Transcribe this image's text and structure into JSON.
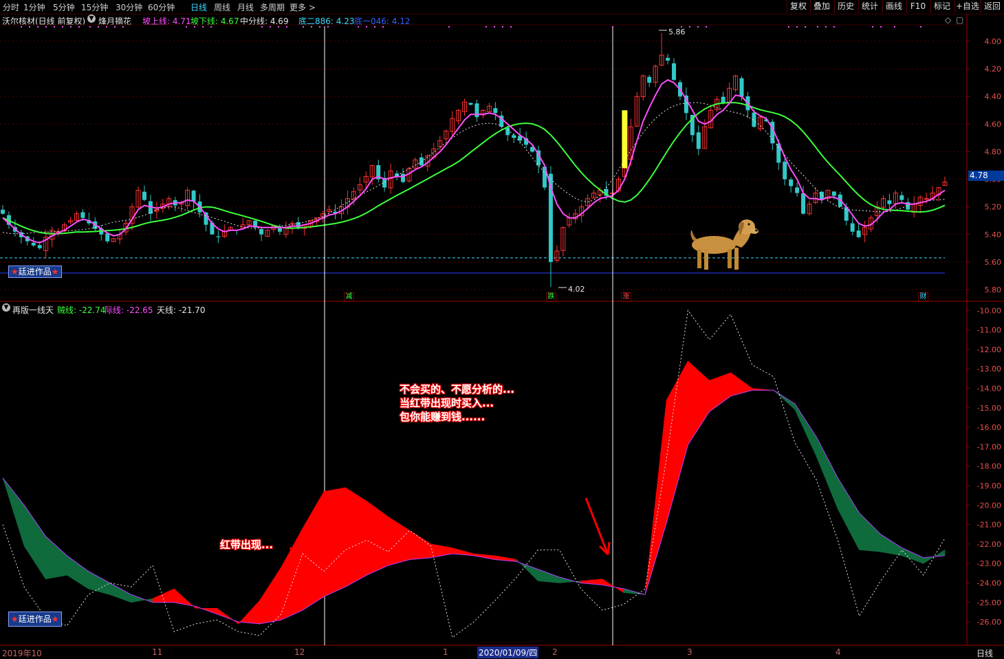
{
  "toolbar": {
    "periods": [
      "分时",
      "1分钟",
      "5分钟",
      "15分钟",
      "30分钟",
      "60分钟",
      "日线",
      "周线",
      "月线",
      "多周期",
      "更多 >"
    ],
    "active": "日线",
    "right": [
      "复权",
      "叠加",
      "历史",
      "统计",
      "画线",
      "F10",
      "标记",
      "+自选",
      "返回"
    ]
  },
  "main": {
    "title": "沃尔核材(日线 前复权)",
    "formula": "烽月摘花",
    "ind": [
      {
        "label": "坡上线: 4.71",
        "color": "#ff4fff"
      },
      {
        "label": "坡下线: 4.67",
        "color": "#3cff3c"
      },
      {
        "label": "中分线: 4.69",
        "color": "#e6e6e6"
      },
      {
        "label": "底二886: 4.23",
        "color": "#3fd9ff"
      },
      {
        "label": "底一046: 4.12",
        "color": "#3060ff"
      }
    ],
    "high_label": "5.86",
    "low_label": "4.02",
    "price_tag": "4.78",
    "yticks": [
      "5.80",
      "5.60",
      "5.40",
      "5.20",
      "5.00",
      "4.80",
      "4.60",
      "4.40",
      "4.20",
      "4.00"
    ],
    "marks": [
      {
        "text": "减",
        "color": "#3cff3c"
      },
      {
        "text": "跌",
        "color": "#3cff3c"
      },
      {
        "text": "涨",
        "color": "#ff5050"
      },
      {
        "text": "财",
        "color": "#3fd9ff"
      }
    ],
    "badge": "廷进作品"
  },
  "sub": {
    "title": "再版一线天",
    "ind": [
      {
        "label": "贼线: -22.74",
        "color": "#3cff3c"
      },
      {
        "label": "际线: -22.65",
        "color": "#ff4fff"
      },
      {
        "label": "天线: -21.70",
        "color": "#e6e6e6"
      }
    ],
    "yticks": [
      "-10.00",
      "-11.00",
      "-12.00",
      "-13.00",
      "-14.00",
      "-15.00",
      "-16.00",
      "-17.00",
      "-18.00",
      "-19.00",
      "-20.00",
      "-21.00",
      "-22.00",
      "-23.00",
      "-24.00",
      "-25.00",
      "-26.00"
    ],
    "badge": "廷进作品",
    "annot_big": "不会买的、不愿分析的...\n当红带出现时买入...\n包你能赚到钱......",
    "annot_small": "红带出现..."
  },
  "xaxis": {
    "labels": [
      "2019年10",
      "11",
      "12",
      "1",
      "2020/01/09/四",
      "2",
      "3",
      "4"
    ],
    "corner": "日线"
  },
  "chart_data": [
    {
      "type": "candlestick",
      "title": "沃尔核材(日线 前复权)",
      "ylim": [
        4.0,
        5.86
      ],
      "yticks": [
        4.0,
        4.2,
        4.4,
        4.6,
        4.8,
        5.0,
        5.2,
        5.4,
        5.6,
        5.8
      ],
      "price_high": 5.86,
      "price_low": 4.02,
      "last_price": 4.78,
      "indicators": {
        "坡上线": 4.71,
        "坡下线": 4.67,
        "中分线": 4.69,
        "底二886": 4.23,
        "底一046": 4.12
      },
      "closes": [
        4.55,
        4.47,
        4.42,
        4.38,
        4.35,
        4.32,
        4.3,
        4.38,
        4.43,
        4.42,
        4.47,
        4.5,
        4.55,
        4.52,
        4.48,
        4.44,
        4.4,
        4.35,
        4.37,
        4.4,
        4.48,
        4.6,
        4.72,
        4.65,
        4.55,
        4.58,
        4.62,
        4.66,
        4.61,
        4.63,
        4.72,
        4.64,
        4.56,
        4.47,
        4.4,
        4.38,
        4.42,
        4.45,
        4.43,
        4.47,
        4.5,
        4.45,
        4.4,
        4.43,
        4.46,
        4.42,
        4.45,
        4.48,
        4.45,
        4.47,
        4.5,
        4.52,
        4.55,
        4.58,
        4.55,
        4.6,
        4.66,
        4.71,
        4.76,
        4.82,
        4.9,
        4.8,
        4.74,
        4.86,
        4.82,
        4.78,
        4.88,
        4.94,
        4.9,
        4.97,
        5.02,
        5.08,
        5.15,
        5.24,
        5.3,
        5.36,
        5.34,
        5.25,
        5.3,
        5.33,
        5.28,
        5.18,
        5.12,
        5.1,
        5.08,
        5.05,
        5.0,
        4.9,
        4.74,
        4.2,
        4.28,
        4.45,
        4.52,
        4.55,
        4.6,
        4.66,
        4.7,
        4.72,
        4.68,
        4.7,
        4.8,
        4.95,
        5.18,
        5.4,
        5.55,
        5.5,
        5.62,
        5.7,
        5.66,
        5.52,
        5.4,
        5.28,
        5.12,
        5.02,
        5.18,
        5.3,
        5.38,
        5.35,
        5.46,
        5.55,
        5.4,
        5.3,
        5.18,
        5.25,
        5.22,
        5.06,
        4.92,
        4.8,
        4.75,
        4.7,
        4.55,
        4.62,
        4.7,
        4.65,
        4.72,
        4.68,
        4.6,
        4.5,
        4.42,
        4.38,
        4.45,
        4.52,
        4.6,
        4.66,
        4.62,
        4.7,
        4.65,
        4.58,
        4.62,
        4.67,
        4.66,
        4.7,
        4.74,
        4.78
      ],
      "kline_ma": [
        4.52,
        4.48,
        4.44,
        4.4,
        4.37,
        4.35,
        4.34,
        4.36,
        4.39,
        4.41,
        4.43,
        4.46,
        4.49,
        4.51,
        4.5,
        4.47,
        4.44,
        4.41,
        4.39,
        4.4,
        4.44,
        4.51,
        4.58,
        4.61,
        4.6,
        4.59,
        4.6,
        4.62,
        4.63,
        4.63,
        4.65,
        4.64,
        4.6,
        4.54,
        4.48,
        4.44,
        4.42,
        4.43,
        4.43,
        4.44,
        4.46,
        4.46,
        4.45,
        4.45,
        4.45,
        4.45,
        4.45,
        4.46,
        4.46,
        4.47,
        4.48,
        4.5,
        4.52,
        4.54,
        4.55,
        4.57,
        4.6,
        4.64,
        4.68,
        4.73,
        4.8,
        4.82,
        4.8,
        4.81,
        4.82,
        4.82,
        4.84,
        4.87,
        4.89,
        4.92,
        4.96,
        5.0,
        5.05,
        5.11,
        5.17,
        5.23,
        5.27,
        5.27,
        5.27,
        5.28,
        5.27,
        5.24,
        5.2,
        5.16,
        5.12,
        5.09,
        5.05,
        4.98,
        4.9,
        4.74,
        4.62,
        4.55,
        4.52,
        4.52,
        4.55,
        4.59,
        4.63,
        4.66,
        4.67,
        4.68,
        4.72,
        4.8,
        4.93,
        5.08,
        5.22,
        5.32,
        5.41,
        5.49,
        5.52,
        5.5,
        5.45,
        5.38,
        5.3,
        5.22,
        5.2,
        5.22,
        5.27,
        5.3,
        5.35,
        5.41,
        5.4,
        5.35,
        5.29,
        5.26,
        5.24,
        5.17,
        5.07,
        4.96,
        4.87,
        4.8,
        4.7,
        4.66,
        4.66,
        4.65,
        4.67,
        4.67,
        4.65,
        4.6,
        4.54,
        4.48,
        4.46,
        4.47,
        4.51,
        4.56,
        4.58,
        4.62,
        4.63,
        4.62,
        4.62,
        4.63,
        4.64,
        4.66,
        4.69,
        4.72
      ]
    },
    {
      "type": "area",
      "title": "再版一线天",
      "ylim": [
        -27.2,
        -9.6
      ],
      "yticks": [
        -10,
        -11,
        -12,
        -13,
        -14,
        -15,
        -16,
        -17,
        -18,
        -19,
        -20,
        -21,
        -22,
        -23,
        -24,
        -25,
        -26
      ],
      "legend": {
        "贼线": -22.74,
        "际线": -22.65,
        "天线": -21.7
      },
      "series": [
        {
          "name": "贼线",
          "values": [
            -18.6,
            -22.1,
            -23.8,
            -23.6,
            -24.3,
            -24.6,
            -25.0,
            -24.8,
            -24.3,
            -25.3,
            -25.3,
            -26.1,
            -24.9,
            -23.2,
            -21.2,
            -19.3,
            -19.1,
            -19.8,
            -20.6,
            -21.3,
            -22.0,
            -22.2,
            -22.5,
            -22.6,
            -22.8,
            -23.9,
            -24.0,
            -23.9,
            -23.8,
            -24.5,
            -24.6,
            -14.6,
            -12.6,
            -13.6,
            -13.2,
            -14.0,
            -14.1,
            -15.1,
            -17.5,
            -20.2,
            -22.3,
            -22.4,
            -22.6,
            -23.0,
            -22.3
          ]
        },
        {
          "name": "际线",
          "values": [
            -18.6,
            -20.0,
            -21.6,
            -22.6,
            -23.4,
            -24.0,
            -24.6,
            -25.0,
            -25.0,
            -25.2,
            -25.6,
            -26.0,
            -26.1,
            -25.9,
            -25.4,
            -24.7,
            -24.2,
            -23.6,
            -23.1,
            -22.8,
            -22.7,
            -22.5,
            -22.6,
            -22.8,
            -22.9,
            -23.3,
            -23.7,
            -24.0,
            -24.1,
            -24.3,
            -24.6,
            -20.9,
            -16.9,
            -15.2,
            -14.4,
            -14.1,
            -14.1,
            -14.8,
            -16.5,
            -18.6,
            -20.4,
            -21.5,
            -22.2,
            -22.7,
            -22.6
          ]
        },
        {
          "name": "天线",
          "values": [
            -21.0,
            -24.2,
            -25.8,
            -26.2,
            -24.6,
            -24.0,
            -24.2,
            -23.1,
            -26.5,
            -26.1,
            -25.9,
            -26.5,
            -26.7,
            -25.6,
            -22.5,
            -23.4,
            -22.3,
            -21.8,
            -22.4,
            -21.3,
            -22.1,
            -26.8,
            -26.0,
            -24.9,
            -23.7,
            -22.3,
            -22.3,
            -24.3,
            -25.4,
            -25.1,
            -24.3,
            -17.6,
            -10.0,
            -11.5,
            -10.2,
            -12.8,
            -13.4,
            -16.8,
            -18.7,
            -21.8,
            -25.7,
            -23.9,
            -22.3,
            -23.6,
            -21.7
          ]
        }
      ]
    }
  ]
}
